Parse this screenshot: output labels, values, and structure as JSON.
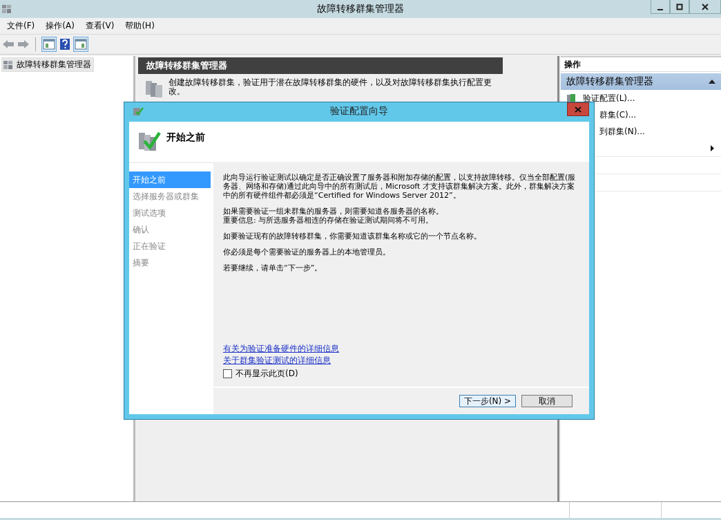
{
  "window": {
    "title": "故障转移群集管理器"
  },
  "menu": [
    "文件(F)",
    "操作(A)",
    "查看(V)",
    "帮助(H)"
  ],
  "tree": [
    {
      "label": "故障转移群集管理器",
      "selected": true
    }
  ],
  "content": {
    "header": "故障转移群集管理器",
    "description": "创建故障转移群集，验证用于潜在故障转移群集的硬件，以及对故障转移群集执行配置更改。"
  },
  "actions": {
    "title": "操作",
    "section": "故障转移群集管理器",
    "items": [
      {
        "label": "验证配置(L)...",
        "kind": "icon"
      },
      {
        "label": "群集(C)...",
        "kind": "plain"
      },
      {
        "label": "到群集(N)...",
        "kind": "plain"
      },
      {
        "kind": "submenu"
      },
      {
        "kind": "plain"
      },
      {
        "kind": "plain"
      }
    ]
  },
  "dialog": {
    "title": "验证配置向导",
    "heading": "开始之前",
    "steps": [
      {
        "label": "开始之前",
        "selected": true
      },
      {
        "label": "选择服务器或群集",
        "selected": false
      },
      {
        "label": "测试选项",
        "selected": false
      },
      {
        "label": "确认",
        "selected": false
      },
      {
        "label": "正在验证",
        "selected": false
      },
      {
        "label": "摘要",
        "selected": false
      }
    ],
    "paragraphs": [
      [
        "此向导运行验证测试以确定是否正确设置了服务器和附加存储的配置，以支持故障转移。仅当全部配置(服务器、网络和存储)通过此向导中的所有测试后，Microsoft 才支持该群集解决方案。此外，群集解决方案中的所有硬件组件都必须是“Certified for Windows Server 2012”。"
      ],
      [
        "如果需要验证一组未群集的服务器，则需要知道各服务器的名称。",
        "重要信息: 与所选服务器相连的存储在验证测试期间将不可用。"
      ],
      [
        "如要验证现有的故障转移群集，你需要知道该群集名称或它的一个节点名称。"
      ],
      [
        "你必须是每个需要验证的服务器上的本地管理员。"
      ],
      [
        "若要继续，请单击“下一步”。"
      ]
    ],
    "links": [
      "有关为验证准备硬件的详细信息",
      "关于群集验证测试的详细信息"
    ],
    "checkbox": {
      "label": "不再显示此页(D)",
      "checked": false
    },
    "buttons": [
      {
        "label": "下一步(N) >",
        "kind": "default"
      },
      {
        "label": "取消",
        "kind": "normal"
      }
    ]
  }
}
